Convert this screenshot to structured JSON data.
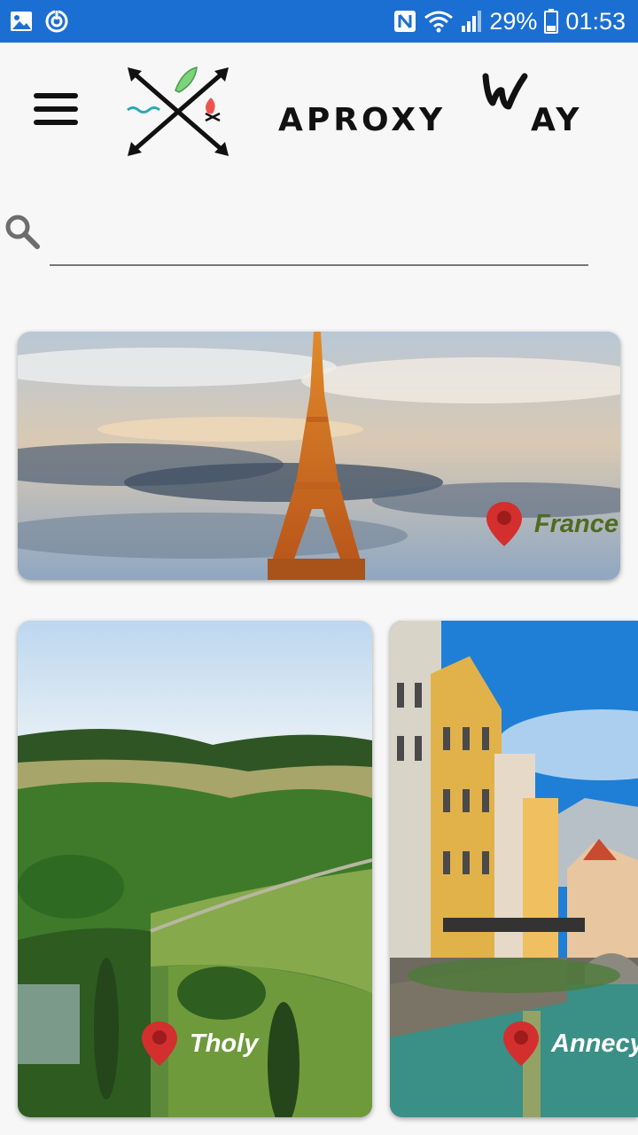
{
  "status_bar": {
    "battery": "29%",
    "time": "01:53",
    "icons": [
      "image-icon",
      "sync-icon",
      "nfc-icon",
      "wifi-icon",
      "signal-icon",
      "battery-icon"
    ],
    "color": "#1c6fd2"
  },
  "header": {
    "menu_icon": "hamburger-menu-icon",
    "logo_icon": "crossed-arrows-logo-icon",
    "brand_left": "APROXY",
    "brand_script_letter": "W",
    "brand_right": "AY"
  },
  "search": {
    "icon": "search-icon",
    "value": "",
    "placeholder": ""
  },
  "destinations": [
    {
      "name": "France",
      "name_color": "#4e6b21",
      "pin_color": "#d32f2f"
    },
    {
      "name": "Tholy",
      "name_color": "#ffffff",
      "pin_color": "#d32f2f"
    },
    {
      "name": "Annecy",
      "name_color": "#ffffff",
      "pin_color": "#d32f2f"
    }
  ]
}
